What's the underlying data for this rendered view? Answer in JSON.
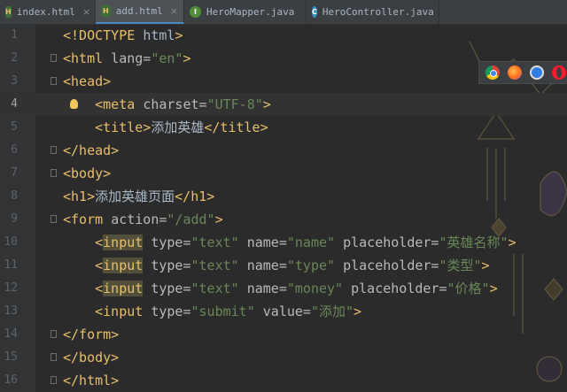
{
  "tabs": [
    {
      "label": "index.html",
      "icon": "html-file-icon",
      "active": false
    },
    {
      "label": "add.html",
      "icon": "html-file-icon",
      "active": true
    },
    {
      "label": "HeroMapper.java",
      "icon": "java-interface-icon",
      "active": false
    },
    {
      "label": "HeroController.java",
      "icon": "java-class-icon",
      "active": false
    }
  ],
  "current_line": 4,
  "lines": [
    {
      "n": "1",
      "parts": [
        [
          "tag",
          "<!DOCTYPE "
        ],
        [
          "txt",
          "html"
        ],
        [
          "tag",
          ">"
        ]
      ]
    },
    {
      "n": "2",
      "parts": [
        [
          "tag",
          "<html "
        ],
        [
          "attr",
          "lang="
        ],
        [
          "str",
          "\"en\""
        ],
        [
          "tag",
          ">"
        ]
      ]
    },
    {
      "n": "3",
      "parts": [
        [
          "tag",
          "<head>"
        ]
      ]
    },
    {
      "n": "4",
      "parts": [
        [
          "txt",
          "    "
        ],
        [
          "tag",
          "<meta "
        ],
        [
          "attr",
          "charset="
        ],
        [
          "str",
          "\"UTF-8\""
        ],
        [
          "tag",
          ">"
        ]
      ]
    },
    {
      "n": "5",
      "parts": [
        [
          "txt",
          "    "
        ],
        [
          "tag",
          "<title>"
        ],
        [
          "txt",
          "添加英雄"
        ],
        [
          "tag",
          "</title>"
        ]
      ]
    },
    {
      "n": "6",
      "parts": [
        [
          "tag",
          "</head>"
        ]
      ]
    },
    {
      "n": "7",
      "parts": [
        [
          "tag",
          "<body>"
        ]
      ]
    },
    {
      "n": "8",
      "parts": [
        [
          "tag",
          "<h1>"
        ],
        [
          "txt",
          "添加英雄页面"
        ],
        [
          "tag",
          "</h1>"
        ]
      ]
    },
    {
      "n": "9",
      "parts": [
        [
          "tag",
          "<form "
        ],
        [
          "attr",
          "action="
        ],
        [
          "str",
          "\"/add\""
        ],
        [
          "tag",
          ">"
        ]
      ]
    },
    {
      "n": "10",
      "parts": [
        [
          "txt",
          "    "
        ],
        [
          "tag",
          "<"
        ],
        [
          "taghl",
          "input"
        ],
        [
          "attr",
          " type="
        ],
        [
          "str",
          "\"text\""
        ],
        [
          "attr",
          " name="
        ],
        [
          "str",
          "\"name\""
        ],
        [
          "attr",
          " placeholder="
        ],
        [
          "str",
          "\"英雄名称\""
        ],
        [
          "tag",
          ">"
        ]
      ]
    },
    {
      "n": "11",
      "parts": [
        [
          "txt",
          "    "
        ],
        [
          "tag",
          "<"
        ],
        [
          "taghl",
          "input"
        ],
        [
          "attr",
          " type="
        ],
        [
          "str",
          "\"text\""
        ],
        [
          "attr",
          " name="
        ],
        [
          "str",
          "\"type\""
        ],
        [
          "attr",
          " placeholder="
        ],
        [
          "str",
          "\"类型\""
        ],
        [
          "tag",
          ">"
        ]
      ]
    },
    {
      "n": "12",
      "parts": [
        [
          "txt",
          "    "
        ],
        [
          "tag",
          "<"
        ],
        [
          "taghl",
          "input"
        ],
        [
          "attr",
          " type="
        ],
        [
          "str",
          "\"text\""
        ],
        [
          "attr",
          " name="
        ],
        [
          "str",
          "\"money\""
        ],
        [
          "attr",
          " placeholder="
        ],
        [
          "str",
          "\"价格\""
        ],
        [
          "tag",
          ">"
        ]
      ]
    },
    {
      "n": "13",
      "parts": [
        [
          "txt",
          "    "
        ],
        [
          "tag",
          "<input "
        ],
        [
          "attr",
          "type="
        ],
        [
          "str",
          "\"submit\""
        ],
        [
          "attr",
          " value="
        ],
        [
          "str",
          "\"添加\""
        ],
        [
          "tag",
          ">"
        ]
      ]
    },
    {
      "n": "14",
      "parts": [
        [
          "tag",
          "</form>"
        ]
      ]
    },
    {
      "n": "15",
      "parts": [
        [
          "tag",
          "</body>"
        ]
      ]
    },
    {
      "n": "16",
      "parts": [
        [
          "tag",
          "</html>"
        ]
      ]
    }
  ],
  "browser_icons": [
    "chrome-icon",
    "firefox-icon",
    "safari-icon",
    "opera-icon"
  ],
  "colors": {
    "tag": "#e8bf6a",
    "attr": "#bababa",
    "string": "#6a8759",
    "text": "#a9b7c6",
    "background": "#2b2b2b"
  }
}
